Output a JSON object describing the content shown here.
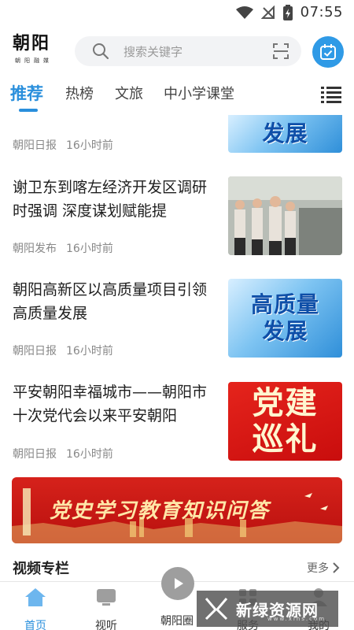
{
  "status_bar": {
    "time": "07:55"
  },
  "header": {
    "logo_title": "朝阳",
    "logo_subtitle": "朝阳融媒",
    "search_placeholder": "搜索关键字"
  },
  "tabs": [
    {
      "label": "推荐",
      "active": true
    },
    {
      "label": "热榜",
      "active": false
    },
    {
      "label": "文旅",
      "active": false
    },
    {
      "label": "中小学课堂",
      "active": false
    }
  ],
  "feed": {
    "top_partial": {
      "source": "朝阳日报",
      "time": "16小时前",
      "thumb_text": "发展"
    },
    "items": [
      {
        "title": "谢卫东到喀左经济开发区调研时强调 深度谋划赋能提",
        "source": "朝阳发布",
        "time": "16小时前"
      },
      {
        "title": "朝阳高新区以高质量项目引领高质量发展",
        "source": "朝阳日报",
        "time": "16小时前",
        "thumb_line1": "高质量",
        "thumb_line2": "发展"
      },
      {
        "title": "平安朝阳幸福城市——朝阳市十次党代会以来平安朝阳",
        "source": "朝阳日报",
        "time": "16小时前",
        "thumb_line1": "党建",
        "thumb_line2": "巡礼"
      }
    ]
  },
  "banner": {
    "text": "党史学习教育知识问答"
  },
  "video_section": {
    "title": "视频专栏",
    "more_label": "更多"
  },
  "bottom_nav": [
    {
      "label": "首页",
      "active": true
    },
    {
      "label": "视听",
      "active": false
    },
    {
      "label": "朝阳圈",
      "active": false
    },
    {
      "label": "服务",
      "active": false
    },
    {
      "label": "我的",
      "active": false
    }
  ],
  "watermark": {
    "text": "新绿资源网",
    "domain": "www.xlhs.com"
  },
  "colors": {
    "accent": "#2a8fdc",
    "banner_red": "#c8130f",
    "meta_gray": "#888888"
  }
}
